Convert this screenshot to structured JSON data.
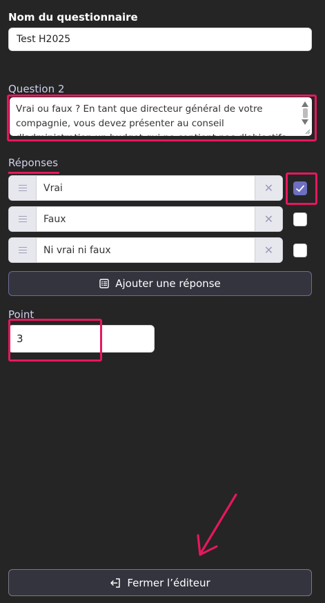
{
  "form": {
    "name_label": "Nom du questionnaire",
    "name_value": "Test H2025",
    "question_label": "Question 2",
    "question_text": "Vrai ou faux ? En tant que directeur général de votre compagnie, vous devez présenter au conseil d'administration un budget qui ne contient pas d'objectifs fixés",
    "answers_label": "Réponses",
    "answers": [
      {
        "text": "Vrai",
        "checked": true
      },
      {
        "text": "Faux",
        "checked": false
      },
      {
        "text": "Ni vrai ni faux",
        "checked": false
      }
    ],
    "add_answer_label": "Ajouter une réponse",
    "point_label": "Point",
    "point_value": "3",
    "close_editor_label": "Fermer l’éditeur"
  },
  "colors": {
    "background": "#252525",
    "highlight": "#e8175d",
    "accent": "#6d6fc0",
    "button_border": "#6b6d9a"
  },
  "icons": [
    "drag-handle-icon",
    "remove-icon",
    "checkmark-icon",
    "list-add-icon",
    "exit-icon",
    "arrow-annotation"
  ]
}
